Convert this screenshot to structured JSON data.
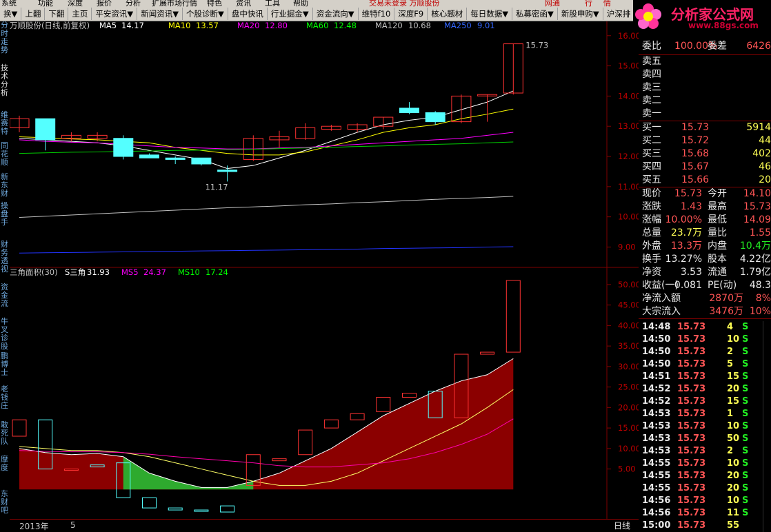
{
  "menu": {
    "items": [
      "系统",
      "功能",
      "深度",
      "报价",
      "分析",
      "扩展市场行情",
      "特色",
      "资讯",
      "工具",
      "帮助"
    ],
    "center_text": "交易未登录   万顺股份",
    "right_buttons": [
      "网通",
      "行",
      "情"
    ]
  },
  "toolbar": {
    "items": [
      "换▼",
      "上翻",
      "下翻",
      "主页",
      "平安资讯▼",
      "新闻资讯▼",
      "个股诊断▼",
      "盘中快讯",
      "行业掘金▼",
      "资金流向▼",
      "维特f10",
      "深度F9",
      "核心题材",
      "每日数据▼",
      "私募密函▼",
      "新股申购▼",
      "沪深排"
    ]
  },
  "left_tabs": [
    "分时走势",
    "技术分析",
    "维赛特",
    "同花顺",
    "新东财",
    "操盘手",
    "财务透视",
    "资金流",
    "牛叉诊股",
    "鹏博士",
    "老钱庄",
    "敢死队",
    "摩度",
    "东财吧"
  ],
  "logo": {
    "title": "分析家公式网",
    "url": "www.88gs.com"
  },
  "chart_data": [
    {
      "type": "candlestick",
      "title": "万顺股份(日线,前复权)",
      "indicators": [
        {
          "name": "MA5",
          "value": "14.17",
          "color": "#ffffff"
        },
        {
          "name": "MA10",
          "value": "13.57",
          "color": "#ffff00"
        },
        {
          "name": "MA20",
          "value": "12.80",
          "color": "#ff00ff"
        },
        {
          "name": "MA60",
          "value": "12.48",
          "color": "#00ff00"
        },
        {
          "name": "MA120",
          "value": "10.68",
          "color": "#c0c0c0"
        },
        {
          "name": "MA250",
          "value": "9.01",
          "color": "#3366ff"
        }
      ],
      "yticks": [
        "16.00",
        "15.00",
        "14.00",
        "13.00",
        "12.00",
        "11.00",
        "10.00",
        "9.00"
      ],
      "ylim": [
        8.6,
        16.2
      ],
      "annotations": [
        "15.73",
        "11.17"
      ],
      "candles": [
        {
          "o": 12.95,
          "h": 13.35,
          "l": 12.8,
          "c": 13.25
        },
        {
          "o": 13.25,
          "h": 13.25,
          "l": 12.2,
          "c": 12.55
        },
        {
          "o": 12.6,
          "h": 12.8,
          "l": 12.5,
          "c": 12.7
        },
        {
          "o": 12.6,
          "h": 12.8,
          "l": 12.5,
          "c": 12.7
        },
        {
          "o": 12.6,
          "h": 12.7,
          "l": 11.9,
          "c": 12.0
        },
        {
          "o": 12.05,
          "h": 12.1,
          "l": 11.95,
          "c": 11.95
        },
        {
          "o": 11.95,
          "h": 12.0,
          "l": 11.75,
          "c": 11.9
        },
        {
          "o": 11.95,
          "h": 11.95,
          "l": 11.7,
          "c": 11.75
        },
        {
          "o": 11.55,
          "h": 11.7,
          "l": 11.17,
          "c": 11.5
        },
        {
          "o": 11.9,
          "h": 12.7,
          "l": 11.85,
          "c": 12.6
        },
        {
          "o": 12.55,
          "h": 12.85,
          "l": 12.3,
          "c": 12.65
        },
        {
          "o": 12.6,
          "h": 13.1,
          "l": 12.55,
          "c": 12.95
        },
        {
          "o": 12.9,
          "h": 13.05,
          "l": 12.85,
          "c": 13.0
        },
        {
          "o": 12.9,
          "h": 13.1,
          "l": 12.8,
          "c": 13.05
        },
        {
          "o": 13.0,
          "h": 13.3,
          "l": 12.9,
          "c": 13.3
        },
        {
          "o": 13.6,
          "h": 13.8,
          "l": 13.4,
          "c": 13.45
        },
        {
          "o": 13.45,
          "h": 13.5,
          "l": 13.05,
          "c": 13.15
        },
        {
          "o": 13.15,
          "h": 14.05,
          "l": 13.1,
          "c": 14.0
        },
        {
          "o": 14.05,
          "h": 14.05,
          "l": 13.15,
          "c": 14.05
        },
        {
          "o": 14.1,
          "h": 15.73,
          "l": 14.05,
          "c": 15.73
        }
      ],
      "ma_lines": {
        "MA5": [
          12.6,
          12.55,
          12.5,
          12.45,
          12.35,
          12.2,
          12.05,
          11.9,
          11.6,
          11.7,
          11.95,
          12.2,
          12.5,
          12.8,
          13.05,
          13.2,
          13.3,
          13.55,
          13.8,
          14.17
        ],
        "MA10": [
          12.65,
          12.62,
          12.58,
          12.55,
          12.5,
          12.45,
          12.3,
          12.2,
          12.1,
          12.05,
          12.05,
          12.15,
          12.35,
          12.55,
          12.8,
          12.95,
          13.05,
          13.25,
          13.4,
          13.57
        ],
        "MA20": [
          12.55,
          12.5,
          12.47,
          12.45,
          12.4,
          12.35,
          12.3,
          12.28,
          12.25,
          12.25,
          12.28,
          12.3,
          12.35,
          12.4,
          12.45,
          12.5,
          12.55,
          12.6,
          12.7,
          12.8
        ],
        "MA60": [
          12.1,
          12.12,
          12.14,
          12.15,
          12.17,
          12.18,
          12.2,
          12.21,
          12.22,
          12.24,
          12.26,
          12.28,
          12.3,
          12.33,
          12.35,
          12.38,
          12.4,
          12.42,
          12.45,
          12.48
        ],
        "MA120": [
          9.98,
          10.02,
          10.06,
          10.1,
          10.14,
          10.18,
          10.22,
          10.26,
          10.3,
          10.33,
          10.36,
          10.4,
          10.43,
          10.47,
          10.5,
          10.54,
          10.58,
          10.61,
          10.64,
          10.68
        ],
        "MA250": [
          8.8,
          8.81,
          8.82,
          8.83,
          8.84,
          8.85,
          8.86,
          8.87,
          8.88,
          8.89,
          8.9,
          8.91,
          8.92,
          8.93,
          8.95,
          8.96,
          8.97,
          8.98,
          9.0,
          9.01
        ]
      }
    },
    {
      "type": "candlestick-area",
      "title": "三角面积(30)",
      "indicators": [
        {
          "name": "S三角",
          "value": "31.93",
          "color": "#ffffff"
        },
        {
          "name": "MS5",
          "value": "24.37",
          "color": "#ff00ff"
        },
        {
          "name": "MS10",
          "value": "17.24",
          "color": "#00ff00"
        }
      ],
      "yticks": [
        "50.00",
        "45.00",
        "40.00",
        "35.00",
        "30.00",
        "25.00",
        "20.00",
        "15.00",
        "10.00",
        "5.00"
      ],
      "ylim": [
        -6,
        52
      ],
      "candles": [
        {
          "o": 13,
          "h": 17,
          "l": 13,
          "c": 17
        },
        {
          "o": 17,
          "h": 17,
          "l": 5,
          "c": 5
        },
        {
          "o": 5,
          "h": 5,
          "l": 5,
          "c": 5
        },
        {
          "o": 6,
          "h": 6,
          "l": 5.5,
          "c": 5.5
        },
        {
          "o": 6.5,
          "h": 6.5,
          "l": -2,
          "c": -2
        },
        {
          "o": -2,
          "h": -2,
          "l": -4.5,
          "c": -4.5
        },
        {
          "o": -4.5,
          "h": -4.5,
          "l": -5,
          "c": -5
        },
        {
          "o": -5,
          "h": -5,
          "l": -5.2,
          "c": -5.2
        },
        {
          "o": -4,
          "h": -4,
          "l": -5.5,
          "c": -5.5
        },
        {
          "o": 1,
          "h": 8.5,
          "l": 1,
          "c": 8.5
        },
        {
          "o": 7,
          "h": 7.5,
          "l": 7,
          "c": 7.5
        },
        {
          "o": 8.5,
          "h": 14.5,
          "l": 8.5,
          "c": 14.5
        },
        {
          "o": 15,
          "h": 17,
          "l": 15,
          "c": 17
        },
        {
          "o": 17,
          "h": 18.5,
          "l": 17,
          "c": 18.5
        },
        {
          "o": 19,
          "h": 22.5,
          "l": 19,
          "c": 22.5
        },
        {
          "o": 22.5,
          "h": 23.5,
          "l": 22.5,
          "c": 23.5
        },
        {
          "o": 24,
          "h": 17.5,
          "l": 17.5,
          "c": 17.5
        },
        {
          "o": 17.5,
          "h": 33,
          "l": 17.5,
          "c": 33
        },
        {
          "o": 33,
          "h": 33.5,
          "l": 33,
          "c": 33.5
        },
        {
          "o": 33.5,
          "h": 51,
          "l": 33.5,
          "c": 51
        }
      ],
      "s_line": [
        10,
        9,
        8.5,
        8.8,
        8,
        4,
        2,
        0.5,
        0.5,
        2,
        4,
        7,
        10,
        14,
        18,
        21,
        24,
        26.5,
        28,
        31.93
      ],
      "ms5": [
        10.5,
        10,
        9.5,
        9.5,
        9,
        8,
        6.5,
        5,
        3.5,
        2,
        1,
        1,
        2,
        4,
        7,
        10,
        13,
        16,
        20,
        24.37
      ],
      "ms10": [
        9.5,
        9.3,
        9.2,
        9.2,
        9,
        8.6,
        8,
        7.5,
        7,
        6.5,
        5.8,
        5.5,
        5.5,
        6,
        6.5,
        7.5,
        9,
        11,
        13.5,
        17.24
      ]
    }
  ],
  "right_panel": {
    "webi": {
      "label": "委比",
      "value": "100.00%",
      "label2": "委差",
      "value2": "6426"
    },
    "sells": [
      {
        "label": "卖五",
        "price": "",
        "vol": ""
      },
      {
        "label": "卖四",
        "price": "",
        "vol": ""
      },
      {
        "label": "卖三",
        "price": "",
        "vol": ""
      },
      {
        "label": "卖二",
        "price": "",
        "vol": ""
      },
      {
        "label": "卖一",
        "price": "",
        "vol": ""
      }
    ],
    "buys": [
      {
        "label": "买一",
        "price": "15.73",
        "vol": "5914"
      },
      {
        "label": "买二",
        "price": "15.72",
        "vol": "44"
      },
      {
        "label": "买三",
        "price": "15.68",
        "vol": "402"
      },
      {
        "label": "买四",
        "price": "15.67",
        "vol": "46"
      },
      {
        "label": "买五",
        "price": "15.66",
        "vol": "20"
      }
    ],
    "stats": [
      {
        "l1": "现价",
        "v1": "15.73",
        "c1": "red",
        "l2": "今开",
        "v2": "14.10",
        "c2": "red"
      },
      {
        "l1": "涨跌",
        "v1": "1.43",
        "c1": "red",
        "l2": "最高",
        "v2": "15.73",
        "c2": "red"
      },
      {
        "l1": "涨幅",
        "v1": "10.00%",
        "c1": "red",
        "l2": "最低",
        "v2": "14.09",
        "c2": "red"
      },
      {
        "l1": "总量",
        "v1": "23.7万",
        "c1": "yellow",
        "l2": "量比",
        "v2": "1.55",
        "c2": "red"
      },
      {
        "l1": "外盘",
        "v1": "13.3万",
        "c1": "red",
        "l2": "内盘",
        "v2": "10.4万",
        "c2": "green"
      },
      {
        "l1": "换手",
        "v1": "13.27%",
        "c1": "white",
        "l2": "股本",
        "v2": "4.22亿",
        "c2": "white"
      },
      {
        "l1": "净资",
        "v1": "3.53",
        "c1": "white",
        "l2": "流通",
        "v2": "1.79亿",
        "c2": "white"
      },
      {
        "l1": "收益(一)",
        "v1": "0.081",
        "c1": "white",
        "l2": "PE(动)",
        "v2": "48.3",
        "c2": "white"
      }
    ],
    "flows": [
      {
        "label": "净流入额",
        "value": "2870万",
        "pct": "8%"
      },
      {
        "label": "大宗流入",
        "value": "3476万",
        "pct": "10%"
      }
    ],
    "ticks": [
      {
        "t": "14:48",
        "p": "15.73",
        "v": "4",
        "s": "S"
      },
      {
        "t": "14:50",
        "p": "15.73",
        "v": "10",
        "s": "S"
      },
      {
        "t": "14:50",
        "p": "15.73",
        "v": "2",
        "s": "S"
      },
      {
        "t": "14:50",
        "p": "15.73",
        "v": "5",
        "s": "S"
      },
      {
        "t": "14:51",
        "p": "15.73",
        "v": "15",
        "s": "S"
      },
      {
        "t": "14:52",
        "p": "15.73",
        "v": "20",
        "s": "S"
      },
      {
        "t": "14:52",
        "p": "15.73",
        "v": "15",
        "s": "S"
      },
      {
        "t": "14:53",
        "p": "15.73",
        "v": "1",
        "s": "S"
      },
      {
        "t": "14:53",
        "p": "15.73",
        "v": "10",
        "s": "S"
      },
      {
        "t": "14:53",
        "p": "15.73",
        "v": "50",
        "s": "S"
      },
      {
        "t": "14:53",
        "p": "15.73",
        "v": "2",
        "s": "S"
      },
      {
        "t": "14:55",
        "p": "15.73",
        "v": "10",
        "s": "S"
      },
      {
        "t": "14:55",
        "p": "15.73",
        "v": "20",
        "s": "S"
      },
      {
        "t": "14:55",
        "p": "15.73",
        "v": "20",
        "s": "S"
      },
      {
        "t": "14:56",
        "p": "15.73",
        "v": "10",
        "s": "S"
      },
      {
        "t": "14:56",
        "p": "15.73",
        "v": "11",
        "s": "S"
      },
      {
        "t": "15:00",
        "p": "15.73",
        "v": "55",
        "s": ""
      }
    ]
  },
  "bottom": {
    "year": "2013年",
    "month": "5",
    "period": "日线"
  },
  "colors": {
    "up": "#ff3232",
    "down": "#54ffff",
    "area": "#8b0000",
    "neg_area": "#2eaa2e",
    "axis": "#800000"
  }
}
